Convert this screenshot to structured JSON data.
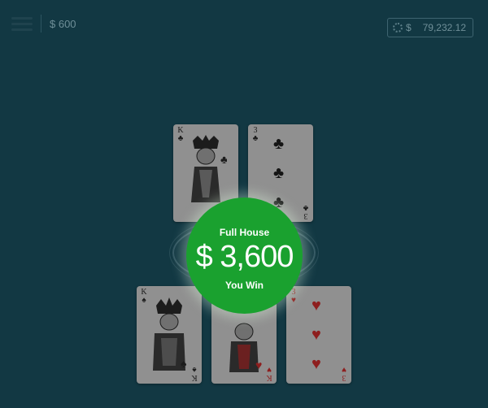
{
  "header": {
    "bet_amount": "$ 600"
  },
  "balance": {
    "currency": "$",
    "amount": "79,232.12"
  },
  "result": {
    "hand_name": "Full House",
    "payout": "$ 3,600",
    "message": "You Win"
  },
  "cards": [
    {
      "rank": "K",
      "suit": "♣",
      "color": "black"
    },
    {
      "rank": "3",
      "suit": "♣",
      "color": "black"
    },
    {
      "rank": "K",
      "suit": "♠",
      "color": "black"
    },
    {
      "rank": "K",
      "suit": "♥",
      "color": "red"
    },
    {
      "rank": "3",
      "suit": "♥",
      "color": "red"
    }
  ],
  "colors": {
    "table": "#123843",
    "win_green": "#1aa12f"
  }
}
